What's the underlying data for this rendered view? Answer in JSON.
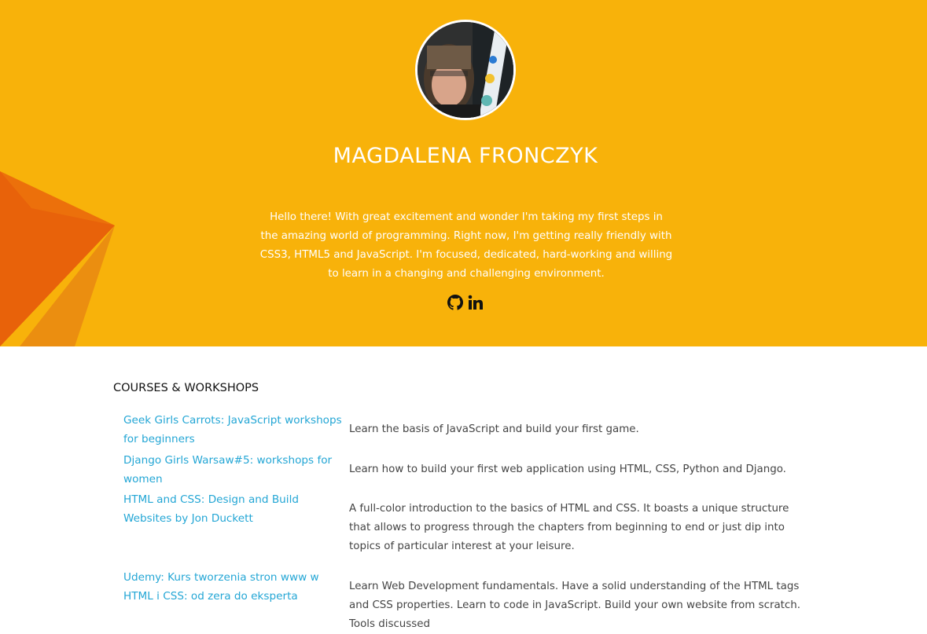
{
  "profile": {
    "name": "MAGDALENA FRONCZYK",
    "bio": "Hello there! With great excitement and wonder I'm taking my first steps in the amazing world of programming. Right now, I'm getting really friendly with CSS3, HTML5 and JavaScript. I'm focused, dedicated, hard-working and willing to learn in a changing and challenging environment.",
    "socials": [
      {
        "icon": "github-icon"
      },
      {
        "icon": "linkedin-icon"
      }
    ]
  },
  "colors": {
    "hero_bg": "#f8b20a",
    "accent_link": "#23a6d5",
    "decor_orange": "#e8680a"
  },
  "courses": {
    "title": "COURSES & WORKSHOPS",
    "items": [
      {
        "title": "Geek Girls Carrots: JavaScript workshops for beginners",
        "description": "Learn the basis of JavaScript and build your first game."
      },
      {
        "title": "Django Girls Warsaw#5: workshops for women",
        "description": "Learn how to build your first web application using HTML, CSS, Python and Django."
      },
      {
        "title": "HTML and CSS: Design and Build Websites by Jon Duckett",
        "description": "A full-color introduction to the basics of HTML and CSS. It boasts a unique structure that allows to progress through the chapters from beginning to end or just dip into topics of particular interest at your leisure."
      },
      {
        "title": "Udemy: Kurs tworzenia stron www w HTML i CSS: od zera do eksperta",
        "description": "Learn Web Development fundamentals. Have a solid understanding of the HTML tags and CSS properties. Learn to code in JavaScript. Build your own website from scratch. Tools discussed"
      }
    ]
  }
}
